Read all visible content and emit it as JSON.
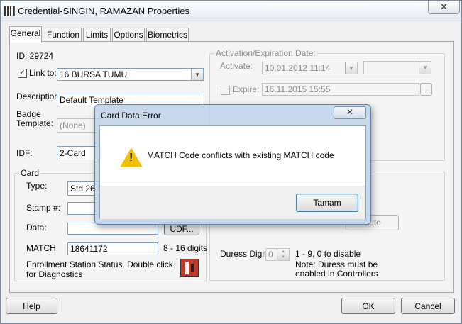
{
  "window": {
    "title": "Credential-SINGIN, RAMAZAN Properties",
    "close_glyph": "✕"
  },
  "tabs": [
    "General",
    "Function",
    "Limits",
    "Options",
    "Biometrics"
  ],
  "general": {
    "id_text": "ID: 29724",
    "link_to_label": "Link to:",
    "link_to_value": "16 BURSA TUMU",
    "description_label": "Description:",
    "description_value": "Default Template",
    "badge_label_1": "Badge",
    "badge_label_2": "Template:",
    "badge_value": "(None)",
    "idf_label": "IDF:",
    "idf_value": "2-Card"
  },
  "card": {
    "group_title": "Card",
    "type_label": "Type:",
    "type_value": "Std 26-b",
    "stamp_label": "Stamp #:",
    "stamp_value": "",
    "data_label": "Data:",
    "data_value": "",
    "udf_label": "UDF...",
    "match_label": "MATCH",
    "match_value": "18641172",
    "match_hint": "8 - 16 digits",
    "status_line_1": "Enrollment Station Status.  Double click",
    "status_line_2": "for Diagnostics"
  },
  "activation": {
    "group_title": "Activation/Expiration Date:",
    "activate_label": "Activate:",
    "activate_value": "10.01.2012 11:14",
    "activate_extra": "",
    "expire_label": "Expire:",
    "expire_value": "16.11.2015 15:55",
    "ellipsis": "..."
  },
  "pin": {
    "auto_label": "Auto",
    "duress_label": "Duress Digit:",
    "duress_value": "0",
    "duress_hint": "1 - 9, 0 to disable",
    "note_1": "Note: Duress must be",
    "note_2": "enabled in Controllers"
  },
  "footer": {
    "help": "Help",
    "ok": "OK",
    "cancel": "Cancel"
  },
  "dialog": {
    "title": "Card Data Error",
    "message": "MATCH Code conflicts with existing MATCH code",
    "button": "Tamam",
    "close_glyph": "✕",
    "icon": "warning-icon"
  },
  "colors": {
    "dialog_frame": "#bed2eb",
    "warning": "#f2c200",
    "status_icon": "#c0392b"
  }
}
